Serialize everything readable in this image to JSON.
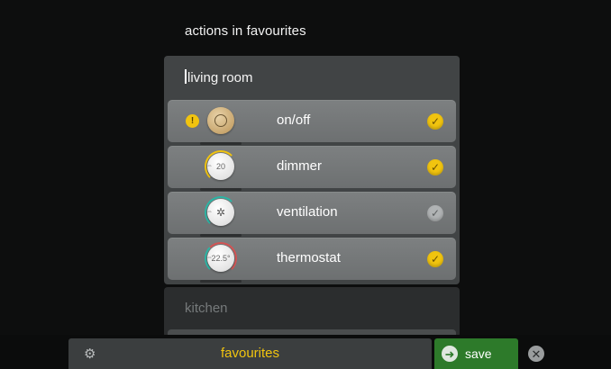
{
  "screen": {
    "title": "actions in favourites"
  },
  "rooms": {
    "living_room": {
      "label": "living room",
      "items": [
        {
          "label": "on/off",
          "checked": true,
          "icon": "power-knob-icon",
          "warning": "!"
        },
        {
          "label": "dimmer",
          "checked": true,
          "icon": "dimmer-knob-icon",
          "value": "20"
        },
        {
          "label": "ventilation",
          "checked": false,
          "icon": "fan-knob-icon",
          "value": "✲"
        },
        {
          "label": "thermostat",
          "checked": true,
          "icon": "thermostat-knob-icon",
          "value": "22.5°"
        }
      ]
    },
    "kitchen": {
      "label": "kitchen"
    }
  },
  "bottom_bar": {
    "favourites_label": "favourites",
    "save_label": "save",
    "settings_icon": "gears-icon",
    "close_icon": "close-icon"
  },
  "colors": {
    "accent": "#f1c40f",
    "save_green": "#2d7a2a",
    "teal_arc": "#2bb5a5",
    "red_arc": "#d35454"
  }
}
